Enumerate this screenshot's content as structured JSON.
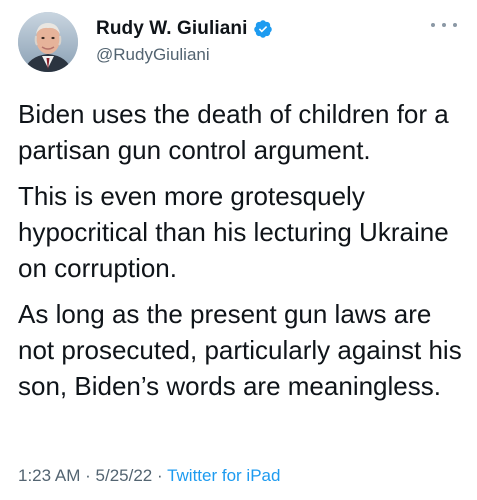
{
  "author": {
    "display_name": "Rudy W. Giuliani",
    "handle": "@RudyGiuliani",
    "verified": true
  },
  "tweet": {
    "paragraphs": [
      "Biden uses the death of children for a partisan gun control argument.",
      "This is even more grotesquely hypocritical than his lecturing Ukraine on corruption.",
      "As long as the present gun laws are not prosecuted, particularly against his son, Biden’s words are meaningless."
    ]
  },
  "meta": {
    "time": "1:23 AM",
    "separator": "·",
    "date": "5/25/22",
    "source": "Twitter for iPad"
  },
  "icons": {
    "verified": "verified-badge-icon",
    "more": "more-dots-icon"
  },
  "colors": {
    "verified": "#1d9bf0",
    "source_link": "#1d9bf0",
    "secondary_text": "#536471"
  }
}
